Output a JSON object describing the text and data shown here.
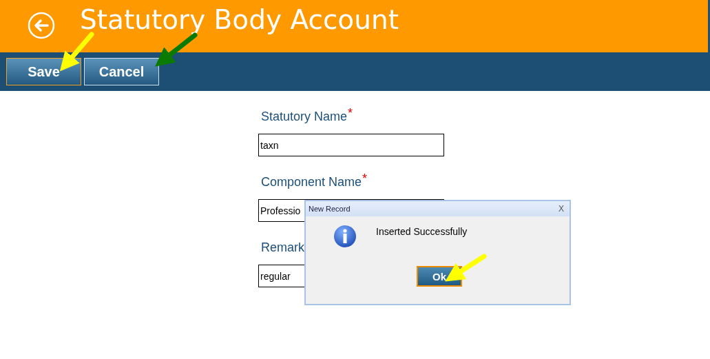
{
  "header": {
    "title": "Statutory Body Account"
  },
  "toolbar": {
    "buttons": [
      {
        "label": "Save",
        "selected": true
      },
      {
        "label": "Cancel",
        "selected": false
      }
    ]
  },
  "form": {
    "fields": [
      {
        "label": "Statutory Name",
        "required_mark": "*",
        "value": "taxn"
      },
      {
        "label": "Component Name",
        "required_mark": "*",
        "value": "Professio"
      },
      {
        "label": "Remark",
        "value": "regular"
      }
    ]
  },
  "dialog": {
    "title": "New Record",
    "close": "X",
    "message": "Inserted Successfully",
    "button": "Ok"
  }
}
